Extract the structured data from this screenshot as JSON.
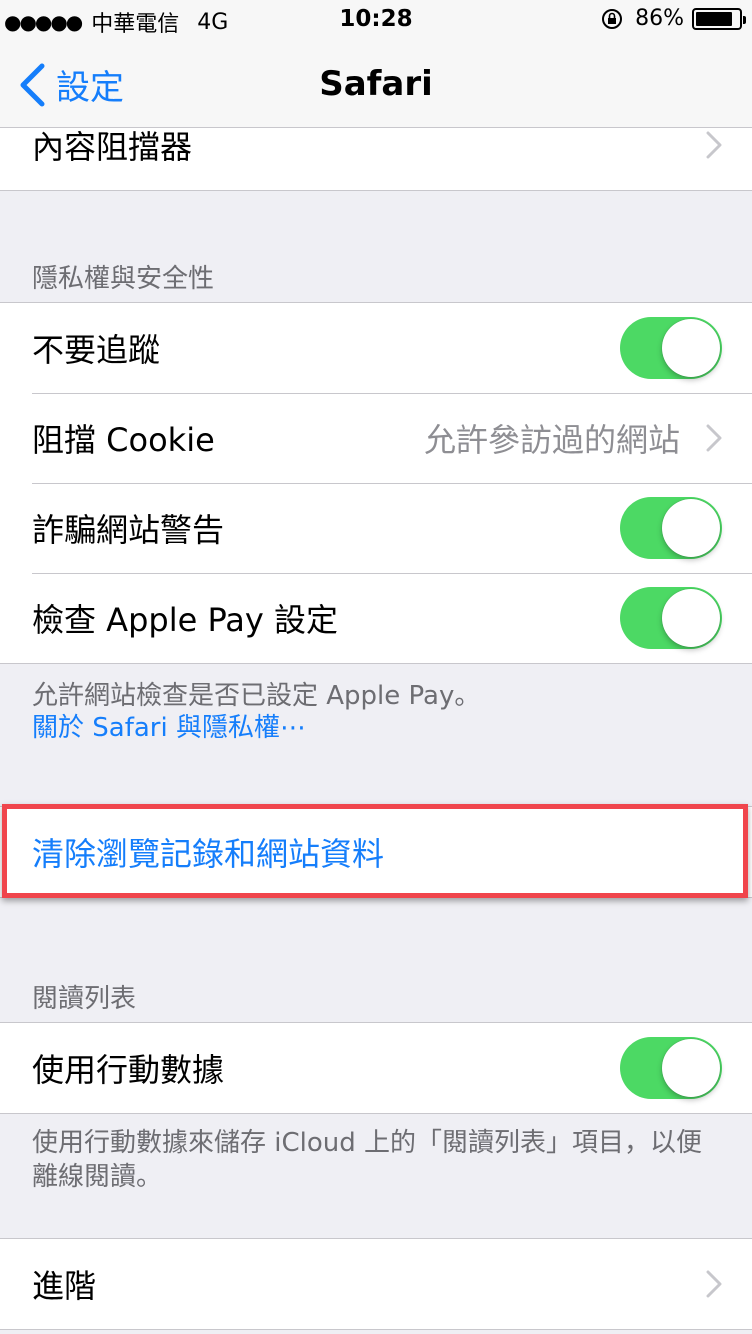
{
  "status_bar": {
    "signal_dots": "●●●●●",
    "carrier": "中華電信",
    "network": "4G",
    "time": "10:28",
    "battery_percent": "86%",
    "battery_level": 0.86
  },
  "nav": {
    "back_label": "設定",
    "title": "Safari"
  },
  "rows": {
    "content_blockers": "內容阻擋器",
    "privacy_header": "隱私權與安全性",
    "do_not_track": "不要追蹤",
    "block_cookies": "阻擋 Cookie",
    "block_cookies_value": "允許參訪過的網站",
    "fraud_warning": "詐騙網站警告",
    "check_apple_pay": "檢查 Apple Pay 設定",
    "privacy_footer": "允許網站檢查是否已設定 Apple Pay。",
    "privacy_link": "關於 Safari 與隱私權⋯",
    "clear_history": "清除瀏覽記錄和網站資料",
    "reading_list_header": "閱讀列表",
    "use_cellular": "使用行動數據",
    "reading_list_footer": "使用行動數據來儲存 iCloud 上的「閱讀列表」項目，以便離線閱讀。",
    "advanced": "進階"
  },
  "toggles": {
    "do_not_track": true,
    "fraud_warning": true,
    "check_apple_pay": true,
    "use_cellular": true
  },
  "colors": {
    "accent": "#157efb",
    "toggle_on": "#4cd964",
    "highlight": "#f0454c",
    "background": "#efeff4"
  }
}
